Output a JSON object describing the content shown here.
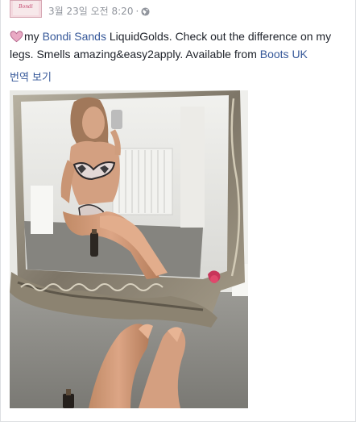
{
  "post": {
    "timestamp": "3월 23일 오전 8:20",
    "separator": "·",
    "audience_icon": "globe-icon",
    "avatar_text": "Bondi"
  },
  "body": {
    "emoji_icon": "heart-emoji",
    "t1": "my ",
    "link1": "Bondi Sands",
    "t2": " LiquidGolds. Check out the difference on my legs. Smells amazing&easy2apply. Available from ",
    "link2": "Boots UK"
  },
  "translate": {
    "label": "번역 보기"
  },
  "colors": {
    "link": "#365899",
    "meta": "#90949c",
    "text": "#1d2129"
  }
}
